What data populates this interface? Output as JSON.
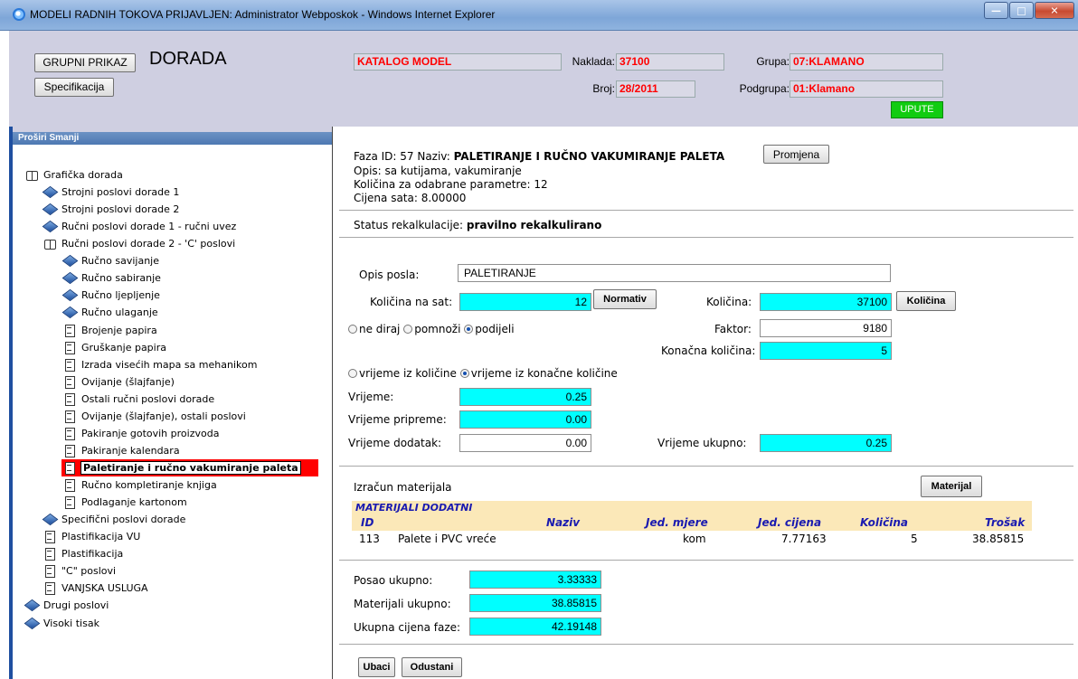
{
  "window": {
    "title": "MODELI RADNIH TOKOVA PRIJAVLJEN: Administrator Webposkok - Windows Internet Explorer"
  },
  "header": {
    "group_button": "GRUPNI PRIKAZ",
    "title": "DORADA",
    "spec_button": "Specifikacija",
    "catalog": "KATALOG MODEL",
    "naklada_label": "Naklada:",
    "naklada_value": "37100",
    "broj_label": "Broj:",
    "broj_value": "28/2011",
    "grupa_label": "Grupa:",
    "grupa_value": "07:KLAMANO",
    "podgrupa_label": "Podgrupa:",
    "podgrupa_value": "01:Klamano",
    "upute_button": "UPUTE"
  },
  "sidebar": {
    "header": "Proširi  Smanji",
    "items": [
      {
        "label": "Grafička dorada",
        "icon": "book"
      },
      {
        "label": "Strojni poslovi dorade 1",
        "icon": "diamond"
      },
      {
        "label": "Strojni poslovi dorade 2",
        "icon": "diamond"
      },
      {
        "label": "Ručni poslovi dorade 1 - ručni uvez",
        "icon": "diamond"
      },
      {
        "label": "Ručni poslovi dorade 2 - 'C' poslovi",
        "icon": "book"
      },
      {
        "label": "Ručno savijanje",
        "icon": "diamond"
      },
      {
        "label": "Ručno sabiranje",
        "icon": "diamond"
      },
      {
        "label": "Ručno ljepljenje",
        "icon": "diamond"
      },
      {
        "label": "Ručno ulaganje",
        "icon": "diamond"
      },
      {
        "label": "Brojenje papira",
        "icon": "doc"
      },
      {
        "label": "Gruškanje papira",
        "icon": "doc"
      },
      {
        "label": "Izrada visećih mapa sa mehanikom",
        "icon": "doc"
      },
      {
        "label": "Ovijanje (šlajfanje)",
        "icon": "doc"
      },
      {
        "label": "Ostali ručni poslovi dorade",
        "icon": "doc"
      },
      {
        "label": "Ovijanje (šlajfanje), ostali poslovi",
        "icon": "doc"
      },
      {
        "label": "Pakiranje gotovih proizvoda",
        "icon": "doc"
      },
      {
        "label": "Pakiranje kalendara",
        "icon": "doc"
      },
      {
        "label": "Paletiranje i ručno vakumiranje paleta",
        "icon": "doc",
        "selected": true
      },
      {
        "label": "Ručno kompletiranje knjiga",
        "icon": "doc"
      },
      {
        "label": "Podlaganje kartonom",
        "icon": "doc"
      },
      {
        "label": "Specifični poslovi dorade",
        "icon": "diamond"
      },
      {
        "label": "Plastifikacija VU",
        "icon": "doc"
      },
      {
        "label": "Plastifikacija",
        "icon": "doc"
      },
      {
        "label": "\"C\" poslovi",
        "icon": "doc"
      },
      {
        "label": "VANJSKA USLUGA",
        "icon": "doc"
      },
      {
        "label": "Drugi poslovi",
        "icon": "diamond"
      },
      {
        "label": "Visoki tisak",
        "icon": "diamond"
      }
    ]
  },
  "phase": {
    "line1_prefix": "Faza ID: 57   Naziv: ",
    "name": "PALETIRANJE I RUČNO VAKUMIRANJE PALETA",
    "change_button": "Promjena",
    "opis": "Opis: sa kutijama, vakumiranje",
    "kolicina_param": "Količina za odabrane parametre: 12",
    "cijena_sata": "Cijena sata: 8.00000",
    "status_label": "Status rekalkulacije: ",
    "status_value": "pravilno rekalkulirano"
  },
  "form": {
    "opis_label": "Opis posla:",
    "opis_value": "PALETIRANJE",
    "kolicina_sat_label": "Količina na sat:",
    "kolicina_sat_value": "12",
    "normativ_button": "Normativ",
    "kolicina_label": "Količina:",
    "kolicina_value": "37100",
    "kolicina_button": "Količina",
    "radio_ne_diraj": "ne diraj",
    "radio_pomnozi": "pomnoži",
    "radio_podijeli": "podijeli",
    "faktor_label": "Faktor:",
    "faktor_value": "9180",
    "konacna_label": "Konačna količina:",
    "konacna_value": "5",
    "radio_vrijeme_kol": "vrijeme iz količine",
    "radio_vrijeme_kon": "vrijeme iz konačne količine",
    "vrijeme_label": "Vrijeme:",
    "vrijeme_value": "0.25",
    "pripreme_label": "Vrijeme pripreme:",
    "pripreme_value": "0.00",
    "dodatak_label": "Vrijeme dodatak:",
    "dodatak_value": "0.00",
    "ukupno_label": "Vrijeme ukupno:",
    "ukupno_value": "0.25"
  },
  "materials": {
    "title": "Izračun materijala",
    "button": "Materijal",
    "section": "MATERIJALI DODATNI",
    "columns": [
      "ID",
      "Naziv",
      "Jed. mjere",
      "Jed. cijena",
      "Količina",
      "Trošak"
    ],
    "rows": [
      [
        "113",
        "Palete i PVC vreće",
        "kom",
        "7.77163",
        "5",
        "38.85815"
      ]
    ]
  },
  "totals": {
    "posao_label": "Posao ukupno:",
    "posao_value": "3.33333",
    "materijali_label": "Materijali ukupno:",
    "materijali_value": "38.85815",
    "cijena_label": "Ukupna cijena faze:",
    "cijena_value": "42.19148"
  },
  "actions": {
    "ubaci": "Ubaci",
    "odustani": "Odustani"
  }
}
